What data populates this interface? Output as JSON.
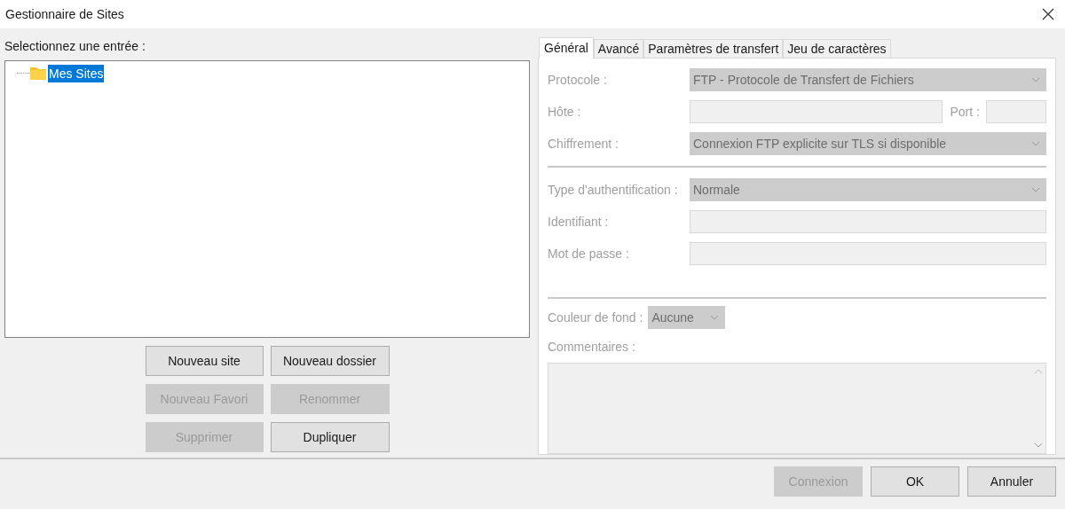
{
  "window": {
    "title": "Gestionnaire de Sites"
  },
  "site_list": {
    "label": "Selectionnez une entrée :",
    "tree": [
      {
        "label": "Mes Sites",
        "selected": true
      }
    ]
  },
  "site_buttons": [
    {
      "label": "Nouveau site",
      "disabled": false
    },
    {
      "label": "Nouveau dossier",
      "disabled": false
    },
    {
      "label": "Nouveau Favori",
      "disabled": true
    },
    {
      "label": "Renommer",
      "disabled": true
    },
    {
      "label": "Supprimer",
      "disabled": true
    },
    {
      "label": "Dupliquer",
      "disabled": false
    }
  ],
  "tabs": [
    {
      "label": "Général",
      "selected": true
    },
    {
      "label": "Avancé",
      "selected": false
    },
    {
      "label": "Paramètres de transfert",
      "selected": false
    },
    {
      "label": "Jeu de caractères",
      "selected": false
    }
  ],
  "general": {
    "fields": [
      {
        "kind": "select",
        "label": "Protocole :",
        "value": "FTP - Protocole de Transfert de Fichiers",
        "disabled": true
      },
      {
        "kind": "host",
        "label": "Hôte :",
        "port_label": "Port :",
        "disabled": true
      },
      {
        "kind": "select",
        "label": "Chiffrement :",
        "value": "Connexion FTP explicite sur TLS si disponible",
        "disabled": true
      },
      {
        "kind": "separator"
      },
      {
        "kind": "select",
        "label": "Type d'authentification :",
        "value": "Normale",
        "disabled": true
      },
      {
        "kind": "text",
        "label": "Identifiant :",
        "disabled": true
      },
      {
        "kind": "text",
        "label": "Mot de passe :",
        "disabled": true
      }
    ],
    "background_color": {
      "label": "Couleur de fond :",
      "value": "Aucune",
      "disabled": true
    },
    "comments": {
      "label": "Commentaires :",
      "disabled": true
    }
  },
  "footer_buttons": [
    {
      "label": "Connexion",
      "disabled": true
    },
    {
      "label": "OK",
      "disabled": false
    },
    {
      "label": "Annuler",
      "disabled": false
    }
  ]
}
